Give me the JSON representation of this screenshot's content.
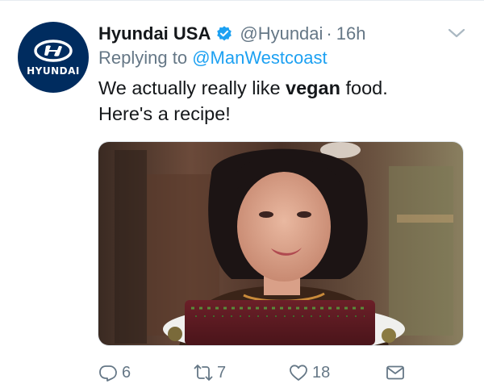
{
  "account": {
    "display_name": "Hyundai USA",
    "handle": "@Hyundai",
    "separator": "·",
    "time": "16h",
    "avatar_text": "HYUNDAI",
    "verified": true
  },
  "reply": {
    "prefix": "Replying to ",
    "mention": "@ManWestcoast"
  },
  "tweet": {
    "text_part1": "We actually really like ",
    "text_bold": "vegan",
    "text_part2": " food.",
    "text_line2": "Here's a recipe!"
  },
  "actions": {
    "reply_count": "6",
    "retweet_count": "7",
    "like_count": "18"
  },
  "icons": {
    "avatar": "hyundai-logo-icon",
    "verified": "verified-badge-icon",
    "caret": "chevron-down-icon",
    "reply": "reply-icon",
    "retweet": "retweet-icon",
    "like": "heart-icon",
    "dm": "envelope-icon"
  },
  "colors": {
    "brand_navy": "#002c5f",
    "twitter_blue": "#1da1f2",
    "muted": "#657786",
    "text": "#14171a"
  }
}
